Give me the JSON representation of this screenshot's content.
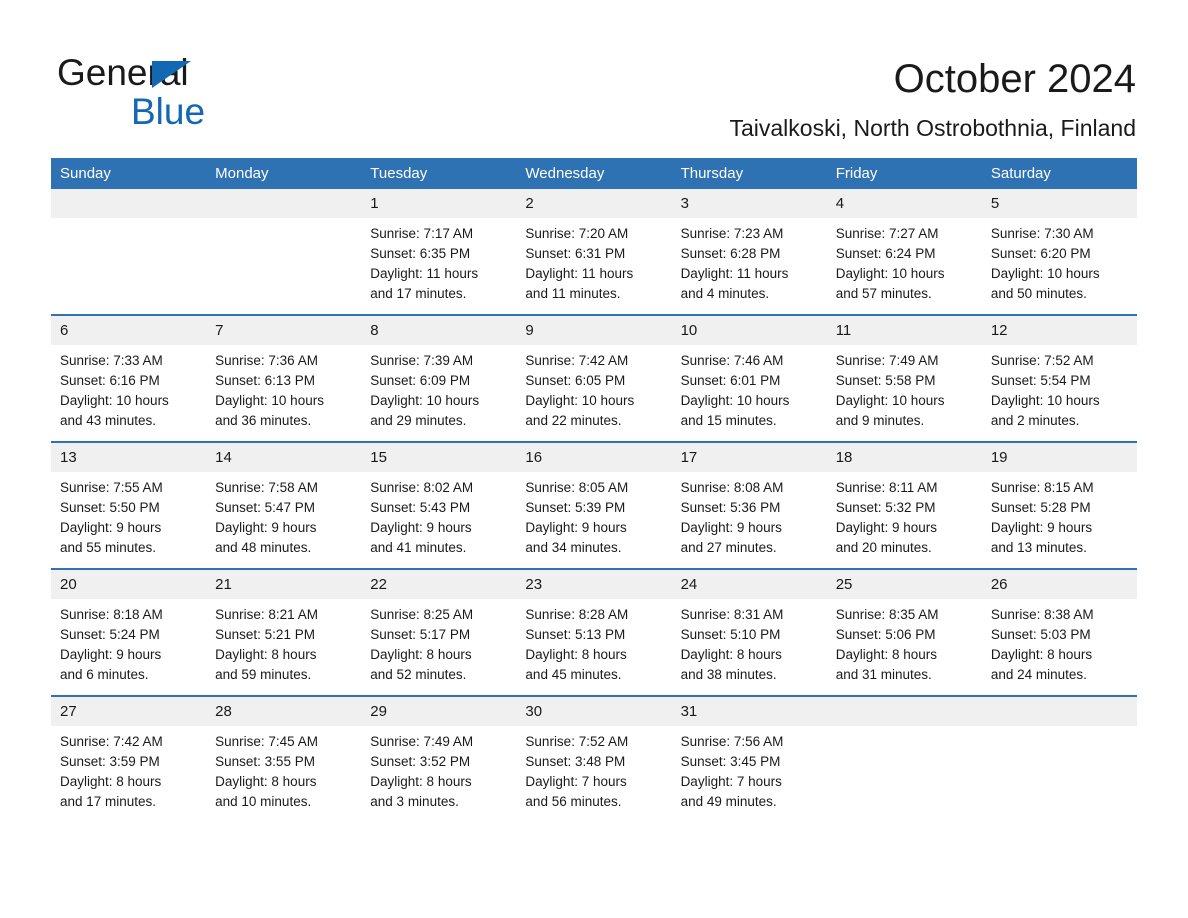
{
  "brand": {
    "name_part1": "General",
    "name_part2": "Blue",
    "accent_color": "#1268b3"
  },
  "header": {
    "title": "October 2024",
    "subtitle": "Taivalkoski, North Ostrobothnia, Finland"
  },
  "calendar": {
    "header_color": "#2e72b4",
    "daynum_bg": "#f0f0f0",
    "weekday_labels": [
      "Sunday",
      "Monday",
      "Tuesday",
      "Wednesday",
      "Thursday",
      "Friday",
      "Saturday"
    ],
    "weeks": [
      [
        {
          "day": "",
          "lines": []
        },
        {
          "day": "",
          "lines": []
        },
        {
          "day": "1",
          "lines": [
            "Sunrise: 7:17 AM",
            "Sunset: 6:35 PM",
            "Daylight: 11 hours",
            "and 17 minutes."
          ]
        },
        {
          "day": "2",
          "lines": [
            "Sunrise: 7:20 AM",
            "Sunset: 6:31 PM",
            "Daylight: 11 hours",
            "and 11 minutes."
          ]
        },
        {
          "day": "3",
          "lines": [
            "Sunrise: 7:23 AM",
            "Sunset: 6:28 PM",
            "Daylight: 11 hours",
            "and 4 minutes."
          ]
        },
        {
          "day": "4",
          "lines": [
            "Sunrise: 7:27 AM",
            "Sunset: 6:24 PM",
            "Daylight: 10 hours",
            "and 57 minutes."
          ]
        },
        {
          "day": "5",
          "lines": [
            "Sunrise: 7:30 AM",
            "Sunset: 6:20 PM",
            "Daylight: 10 hours",
            "and 50 minutes."
          ]
        }
      ],
      [
        {
          "day": "6",
          "lines": [
            "Sunrise: 7:33 AM",
            "Sunset: 6:16 PM",
            "Daylight: 10 hours",
            "and 43 minutes."
          ]
        },
        {
          "day": "7",
          "lines": [
            "Sunrise: 7:36 AM",
            "Sunset: 6:13 PM",
            "Daylight: 10 hours",
            "and 36 minutes."
          ]
        },
        {
          "day": "8",
          "lines": [
            "Sunrise: 7:39 AM",
            "Sunset: 6:09 PM",
            "Daylight: 10 hours",
            "and 29 minutes."
          ]
        },
        {
          "day": "9",
          "lines": [
            "Sunrise: 7:42 AM",
            "Sunset: 6:05 PM",
            "Daylight: 10 hours",
            "and 22 minutes."
          ]
        },
        {
          "day": "10",
          "lines": [
            "Sunrise: 7:46 AM",
            "Sunset: 6:01 PM",
            "Daylight: 10 hours",
            "and 15 minutes."
          ]
        },
        {
          "day": "11",
          "lines": [
            "Sunrise: 7:49 AM",
            "Sunset: 5:58 PM",
            "Daylight: 10 hours",
            "and 9 minutes."
          ]
        },
        {
          "day": "12",
          "lines": [
            "Sunrise: 7:52 AM",
            "Sunset: 5:54 PM",
            "Daylight: 10 hours",
            "and 2 minutes."
          ]
        }
      ],
      [
        {
          "day": "13",
          "lines": [
            "Sunrise: 7:55 AM",
            "Sunset: 5:50 PM",
            "Daylight: 9 hours",
            "and 55 minutes."
          ]
        },
        {
          "day": "14",
          "lines": [
            "Sunrise: 7:58 AM",
            "Sunset: 5:47 PM",
            "Daylight: 9 hours",
            "and 48 minutes."
          ]
        },
        {
          "day": "15",
          "lines": [
            "Sunrise: 8:02 AM",
            "Sunset: 5:43 PM",
            "Daylight: 9 hours",
            "and 41 minutes."
          ]
        },
        {
          "day": "16",
          "lines": [
            "Sunrise: 8:05 AM",
            "Sunset: 5:39 PM",
            "Daylight: 9 hours",
            "and 34 minutes."
          ]
        },
        {
          "day": "17",
          "lines": [
            "Sunrise: 8:08 AM",
            "Sunset: 5:36 PM",
            "Daylight: 9 hours",
            "and 27 minutes."
          ]
        },
        {
          "day": "18",
          "lines": [
            "Sunrise: 8:11 AM",
            "Sunset: 5:32 PM",
            "Daylight: 9 hours",
            "and 20 minutes."
          ]
        },
        {
          "day": "19",
          "lines": [
            "Sunrise: 8:15 AM",
            "Sunset: 5:28 PM",
            "Daylight: 9 hours",
            "and 13 minutes."
          ]
        }
      ],
      [
        {
          "day": "20",
          "lines": [
            "Sunrise: 8:18 AM",
            "Sunset: 5:24 PM",
            "Daylight: 9 hours",
            "and 6 minutes."
          ]
        },
        {
          "day": "21",
          "lines": [
            "Sunrise: 8:21 AM",
            "Sunset: 5:21 PM",
            "Daylight: 8 hours",
            "and 59 minutes."
          ]
        },
        {
          "day": "22",
          "lines": [
            "Sunrise: 8:25 AM",
            "Sunset: 5:17 PM",
            "Daylight: 8 hours",
            "and 52 minutes."
          ]
        },
        {
          "day": "23",
          "lines": [
            "Sunrise: 8:28 AM",
            "Sunset: 5:13 PM",
            "Daylight: 8 hours",
            "and 45 minutes."
          ]
        },
        {
          "day": "24",
          "lines": [
            "Sunrise: 8:31 AM",
            "Sunset: 5:10 PM",
            "Daylight: 8 hours",
            "and 38 minutes."
          ]
        },
        {
          "day": "25",
          "lines": [
            "Sunrise: 8:35 AM",
            "Sunset: 5:06 PM",
            "Daylight: 8 hours",
            "and 31 minutes."
          ]
        },
        {
          "day": "26",
          "lines": [
            "Sunrise: 8:38 AM",
            "Sunset: 5:03 PM",
            "Daylight: 8 hours",
            "and 24 minutes."
          ]
        }
      ],
      [
        {
          "day": "27",
          "lines": [
            "Sunrise: 7:42 AM",
            "Sunset: 3:59 PM",
            "Daylight: 8 hours",
            "and 17 minutes."
          ]
        },
        {
          "day": "28",
          "lines": [
            "Sunrise: 7:45 AM",
            "Sunset: 3:55 PM",
            "Daylight: 8 hours",
            "and 10 minutes."
          ]
        },
        {
          "day": "29",
          "lines": [
            "Sunrise: 7:49 AM",
            "Sunset: 3:52 PM",
            "Daylight: 8 hours",
            "and 3 minutes."
          ]
        },
        {
          "day": "30",
          "lines": [
            "Sunrise: 7:52 AM",
            "Sunset: 3:48 PM",
            "Daylight: 7 hours",
            "and 56 minutes."
          ]
        },
        {
          "day": "31",
          "lines": [
            "Sunrise: 7:56 AM",
            "Sunset: 3:45 PM",
            "Daylight: 7 hours",
            "and 49 minutes."
          ]
        },
        {
          "day": "",
          "lines": []
        },
        {
          "day": "",
          "lines": []
        }
      ]
    ]
  }
}
